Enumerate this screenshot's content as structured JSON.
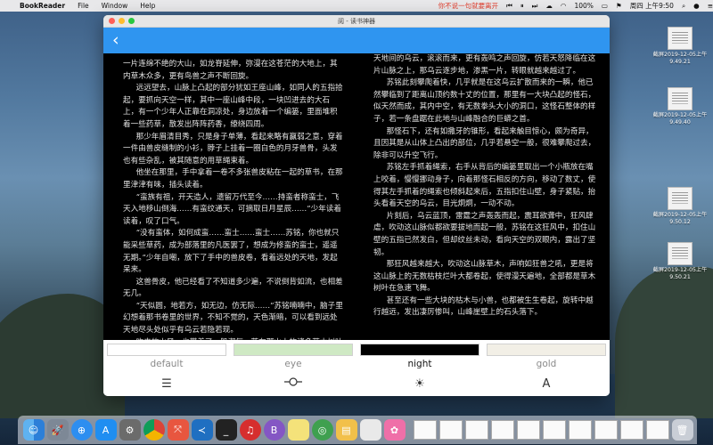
{
  "menubar": {
    "app_name": "BookReader",
    "items": [
      "File",
      "Window",
      "Help"
    ],
    "marquee": "你不说一句就要离开",
    "battery": "100%",
    "clock": "周四 上午9:50"
  },
  "window": {
    "title": "阅 - 读书神器"
  },
  "reader": {
    "left_paragraphs": [
      "一片连绵不绝的大山，如龙脊延伸，弥漫在这苍茫的大地上，其内草木众多，更有鸟兽之声不断回旋。",
      "远远望去，山脉上凸起的部分犹如王座山峰，如同人的五指拾起，要抓向天空一样，其中一座山峰中段，一块凹进去的大石上，有一个少年人正靠在洞凉处，身边放着一个编篓，里面堆积着一些药草，散发出阵阵药香，缭绕四周。",
      "那少年眉清目秀，只是身子单薄，看起来略有赢弱之意，穿着一件由兽皮缝制的小衫，脖子上挂着一圈白色的月牙兽骨，头发也有些杂乱，被其随意的用草绳束着。",
      "他坐在那里，手中拿着一卷不多张兽皮粘在一起的草书，在那里津津有味，插头读着。",
      "“蛮族有祖，开天造人，遗留万代至今……持蛮者称蛮士，飞天入地移山倒海……有蛮纹通天，可摘取日月星辰……”少年读着读着，叹了口气。",
      "“没有蛮体，如何成蛮……蛮士……蛮士……苏铭，你也就只能采些草药，成为部落里的凡医罢了，想成为修蛮的蛮士，遥遥无期。”少年自嘲，放下了手中的兽皮卷，看着远处的天地，发起呆来。",
      "这兽骨皮，他已经看了不知道多少遍，不说倒背如流，也相差无几。",
      "“天似圆，地若方，如无边，仿无际……”苏铭喃喃中，脑子里幻想着那书卷里的世界，不知不觉的，天色渐暗，可以看到远处天地尽头处似乎有乌云若隐若现。",
      "吹来的山风，也带着了一股潮气，落在那山上的诸多草木树叶上，发出陈陈哗啦的声响。"
    ],
    "right_paragraphs": [
      {
        "text": "天地间的乌云，滚滚而来，更有轰鸣之声回旋，仿若天怒降临在这片山脉之上，那乌云逐步地，渗黑一片，转眼就越来越过了。",
        "indent": false
      },
      {
        "text": "苏铭此刻攀爬着快，几乎就是在这乌云扩散而来的一瞬，他已然攀临到了距离山顶约数十丈的位置，那里有一大块凸起的怪石，似天然而成，其内中空，有无数拳头大小的洞口，这怪石整体的样子，若一条盘踞在此地与山峰融合的巨蟒之首。",
        "indent": true
      },
      {
        "text": "那怪石下，还有如撒牙的锥形，看起来触目惊心，颇为奇异，且因其是从山体上凸出的部位，几乎若悬空一般，很难攀爬过去，除非可以升空飞行。",
        "indent": true
      },
      {
        "text": "苏铭左手抓着绳索，右手从背后的编篓里取出一个小瓶放在嘴上咬着，慢慢挪动身子，向着那怪石相反的方向，移动了数丈，使得其左手抓着的绳索也倾斜起来后，五指扣住山壁，身子紧贴，抬头看着天空的乌云，目光炯炯，一动不动。",
        "indent": true
      },
      {
        "text": "片刻后，乌云蓝顶，雷霆之声轰轰而起，震耳欲聋中，狂风肆虐，吹动这山脉似都欲要拔地而起一般，苏铭在这狂风中，扣住山壁的五指已然发白，但却纹丝未动，看向天空的双眼内，露出了坚韧。",
        "indent": true
      },
      {
        "text": "那狂风越来越大，吹动这山脉草木，声响如狂兽之吼，更是将这山脉上的无数枯枝烂叶大都卷起，使得漫天遍地，全部都是草木树叶在急速飞舞。",
        "indent": true
      },
      {
        "text": "甚至还有一些大块的枯木与小兽，也都被生生卷起，旋转中越行越远，发出凄厉惨叫，山峰崖壁上的石头落下。",
        "indent": true
      }
    ]
  },
  "themes": {
    "labels": [
      "default",
      "eye",
      "night",
      "gold"
    ],
    "active": "night",
    "colors": [
      "#ffffff",
      "#cfe9c4",
      "#000000",
      "#f2efe6"
    ]
  },
  "tools": {
    "menu": "☰",
    "progress": "-o-",
    "brightness": "☀",
    "font": "A"
  },
  "desktop_items": [
    "截屏2019-12-05上午9.49.21",
    "截屏2019-12-05上午9.49.40",
    "截屏2019-12-05上午9.50.12",
    "截屏2019-12-05上午9.50.21"
  ],
  "dock": {
    "apps": [
      "finder",
      "launchpad",
      "safari",
      "app-store",
      "preferences",
      "chrome",
      "git-tool",
      "vs-code",
      "terminal",
      "netease-music",
      "xcode-b",
      "notes",
      "android-studio",
      "archive",
      "photos",
      "flower",
      "text-doc",
      "trash"
    ]
  }
}
